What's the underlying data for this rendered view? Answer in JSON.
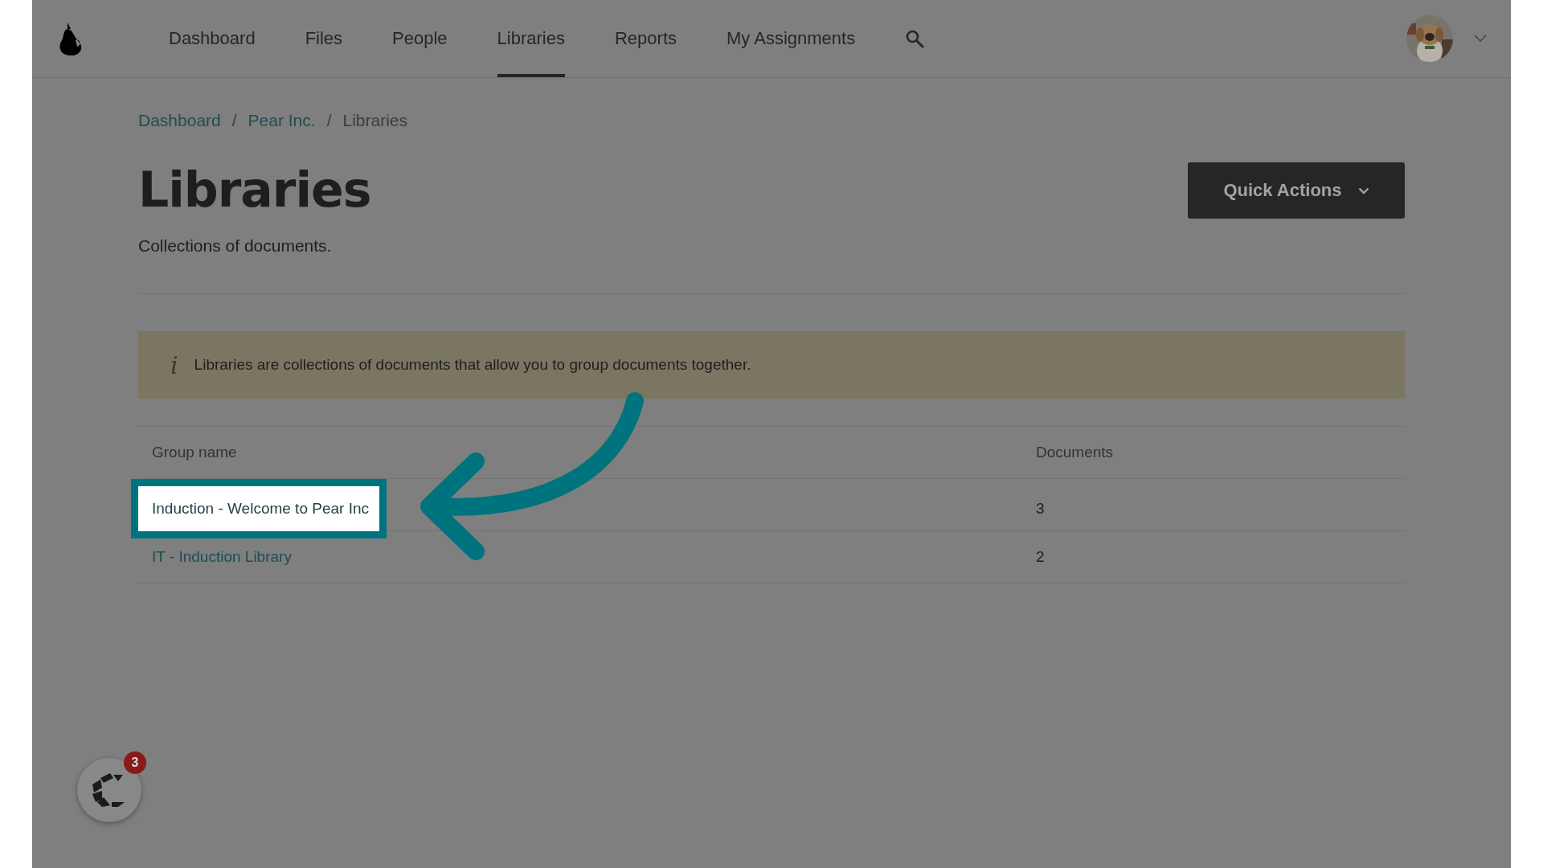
{
  "nav": {
    "items": [
      {
        "label": "Dashboard",
        "selected": false
      },
      {
        "label": "Files",
        "selected": false
      },
      {
        "label": "People",
        "selected": false
      },
      {
        "label": "Libraries",
        "selected": true
      },
      {
        "label": "Reports",
        "selected": false
      },
      {
        "label": "My Assignments",
        "selected": false
      }
    ]
  },
  "breadcrumb": [
    {
      "label": "Dashboard",
      "link": true
    },
    {
      "label": "Pear Inc.",
      "link": true
    },
    {
      "label": "Libraries",
      "link": false
    }
  ],
  "breadcrumb_separator": "/",
  "page": {
    "title": "Libraries",
    "subtitle": "Collections of documents.",
    "action_button": "Quick Actions"
  },
  "info_banner": {
    "icon": "i",
    "text": "Libraries are collections of documents that allow you to group documents together."
  },
  "table": {
    "columns": [
      "Group name",
      "Documents"
    ],
    "rows": [
      {
        "name": "Induction - Welcome to Pear Inc",
        "documents": "3",
        "highlighted": true
      },
      {
        "name": "IT - Induction Library",
        "documents": "2",
        "highlighted": false
      }
    ]
  },
  "help_widget": {
    "badge": "3"
  }
}
